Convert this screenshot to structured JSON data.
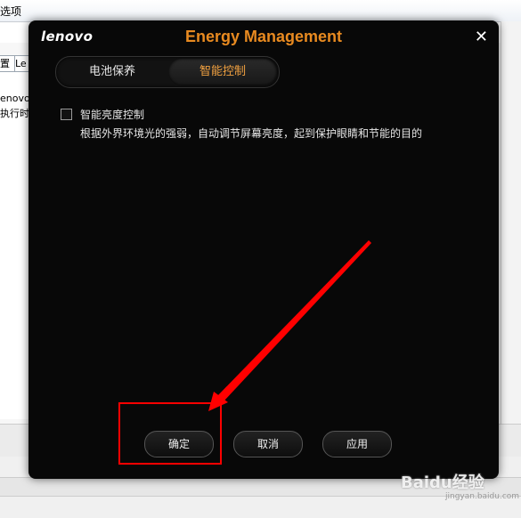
{
  "background": {
    "title_fragment": "选项",
    "tab_fragment_1": "置",
    "tab_fragment_2": "Le",
    "text_line_1": "enovo E",
    "text_line_2": "执行时节"
  },
  "dialog": {
    "logo": "lenovo",
    "title": "Energy Management",
    "close_symbol": "✕",
    "tabs": [
      {
        "label": "电池保养"
      },
      {
        "label": "智能控制",
        "selected": true
      }
    ],
    "option": {
      "label": "智能亮度控制",
      "checked": false,
      "description": "根据外界环境光的强弱，自动调节屏幕亮度，起到保护眼睛和节能的目的"
    },
    "buttons": {
      "ok": "确定",
      "cancel": "取消",
      "apply": "应用"
    }
  },
  "colors": {
    "accent": "#e88a20",
    "annotation": "#ff0000"
  },
  "watermark": {
    "text": "Baidu经验",
    "sub": "jingyan.baidu.com"
  }
}
